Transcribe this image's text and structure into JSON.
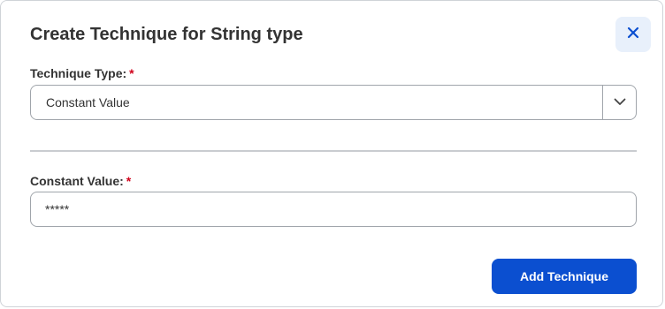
{
  "dialog": {
    "title": "Create Technique for String type",
    "close_icon": "close-icon"
  },
  "technique_type": {
    "label": "Technique Type:",
    "required_mark": "*",
    "selected_value": "Constant Value",
    "arrow_icon": "chevron-down-icon"
  },
  "constant_value": {
    "label": "Constant Value:",
    "required_mark": "*",
    "value": "*****"
  },
  "footer": {
    "add_label": "Add Technique"
  },
  "colors": {
    "primary": "#0b4fd0",
    "close_bg": "#e8f0fb",
    "required": "#d0021b"
  }
}
